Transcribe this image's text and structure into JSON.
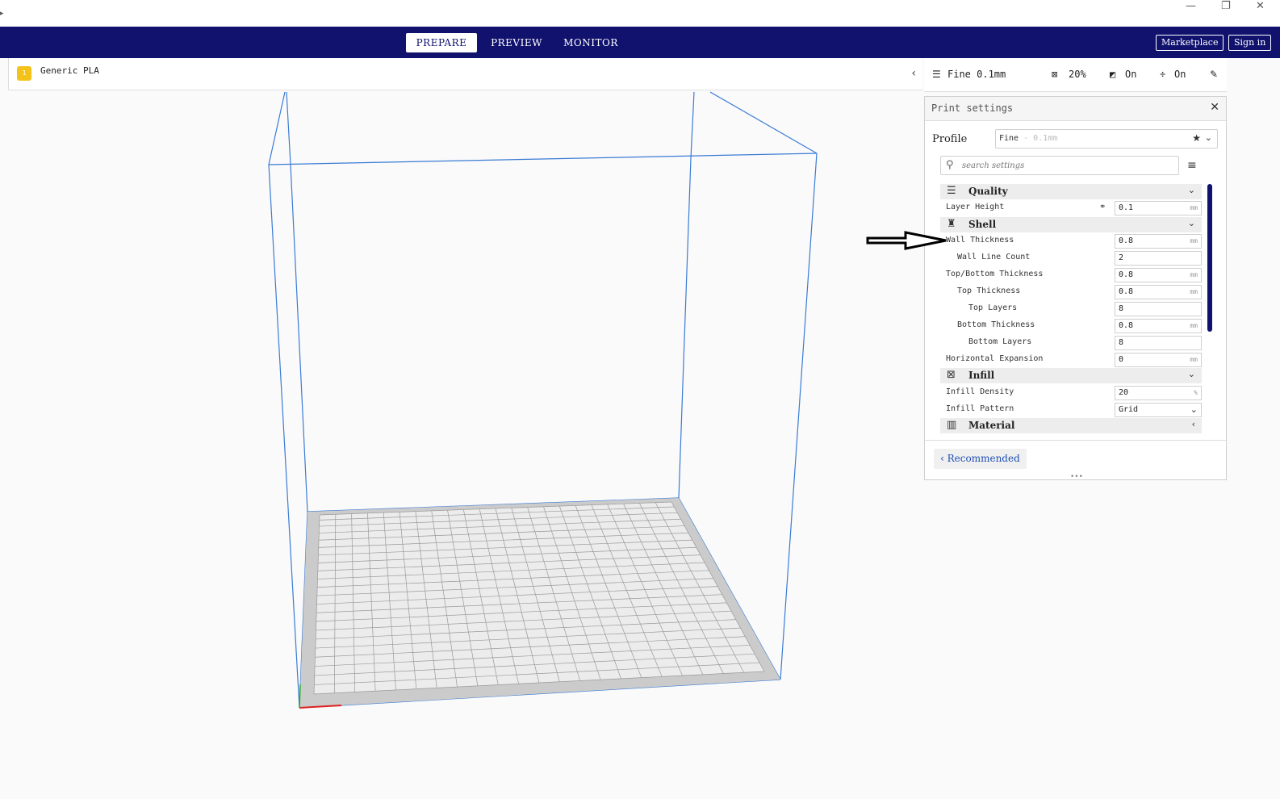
{
  "window": {
    "minimize": "—",
    "maximize": "❐",
    "close": "✕"
  },
  "nav": {
    "tabs": [
      {
        "label": "PREPARE",
        "active": true
      },
      {
        "label": "PREVIEW",
        "active": false
      },
      {
        "label": "MONITOR",
        "active": false
      }
    ],
    "marketplace": "Marketplace",
    "signin": "Sign in"
  },
  "material": {
    "badge": "1",
    "name": "Generic PLA"
  },
  "quick": {
    "profile": "Fine 0.1mm",
    "infill": "20%",
    "support": "On",
    "adhesion": "On"
  },
  "panel": {
    "title": "Print settings",
    "profile_label": "Profile",
    "profile_value": "Fine",
    "profile_sub": " - 0.1mm",
    "search_placeholder": "search settings",
    "categories": [
      {
        "label": "Quality",
        "icon": "quality-icon",
        "chevron": "⌄"
      },
      {
        "label": "Shell",
        "icon": "shell-icon",
        "chevron": "⌄"
      },
      {
        "label": "Infill",
        "icon": "infill-icon",
        "chevron": "⌄"
      },
      {
        "label": "Material",
        "icon": "material-icon",
        "chevron": "‹"
      }
    ],
    "settings": [
      {
        "label": "Layer Height",
        "value": "0.1",
        "unit": "mm"
      },
      {
        "label": "Wall Thickness",
        "value": "0.8",
        "unit": "mm"
      },
      {
        "label": "Wall Line Count",
        "value": "2",
        "unit": ""
      },
      {
        "label": "Top/Bottom Thickness",
        "value": "0.8",
        "unit": "mm"
      },
      {
        "label": "Top Thickness",
        "value": "0.8",
        "unit": "mm"
      },
      {
        "label": "Top Layers",
        "value": "8",
        "unit": ""
      },
      {
        "label": "Bottom Thickness",
        "value": "0.8",
        "unit": "mm"
      },
      {
        "label": "Bottom Layers",
        "value": "8",
        "unit": ""
      },
      {
        "label": "Horizontal Expansion",
        "value": "0",
        "unit": "mm"
      },
      {
        "label": "Infill Density",
        "value": "20",
        "unit": "%"
      },
      {
        "label": "Infill Pattern",
        "value": "Grid",
        "unit": "⌄"
      }
    ],
    "recommended": "Recommended"
  },
  "colors": {
    "nav": "#10126e",
    "accent": "#1d4fb3",
    "badge": "#f3c319",
    "volume": "#3a7bd5"
  }
}
